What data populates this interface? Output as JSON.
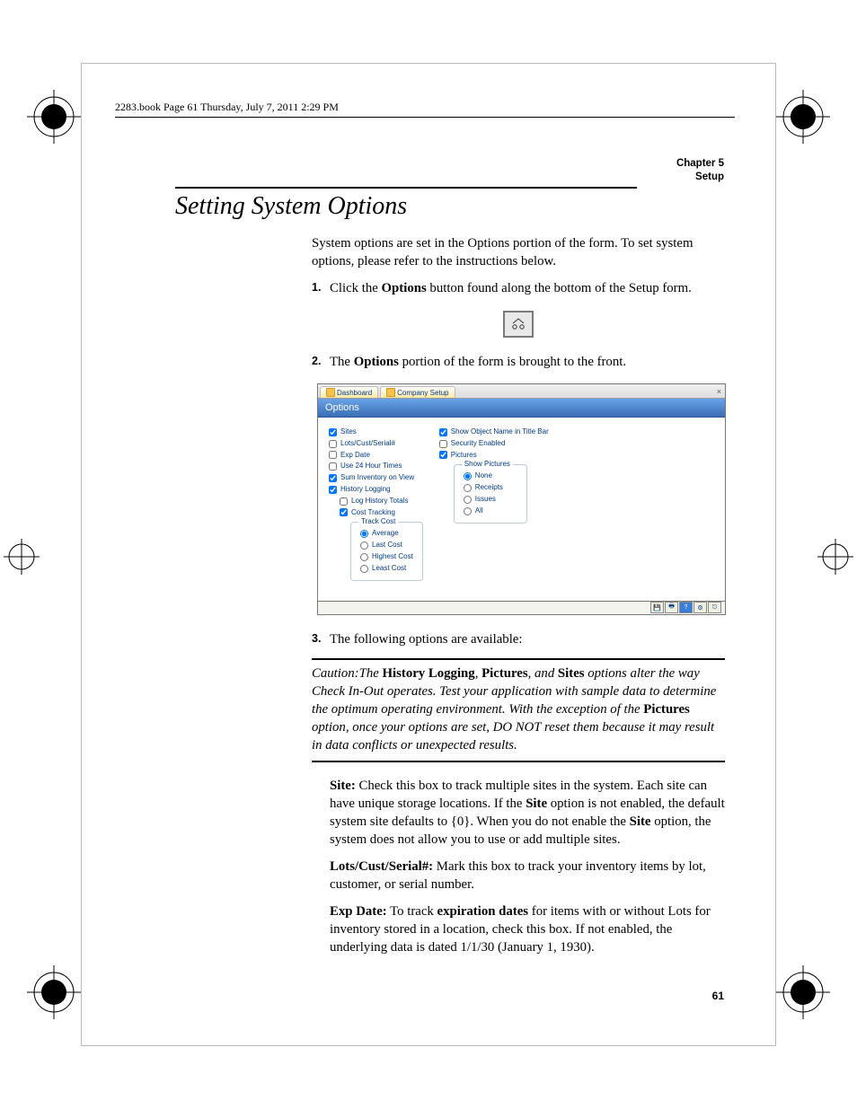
{
  "header_line": "2283.book  Page 61  Thursday, July 7, 2011  2:29 PM",
  "running_head": {
    "line1": "Chapter 5",
    "line2": "Setup"
  },
  "section_title": "Setting System Options",
  "intro": "System options are set in the Options portion of the form. To set system options, please refer to the instructions below.",
  "step1_num": "1.",
  "step1_pre": "Click the ",
  "step1_bold": "Options",
  "step1_post": " button found along the bottom of the Setup form.",
  "step2_num": "2.",
  "step2_pre": "The ",
  "step2_bold": "Options",
  "step2_post": " portion of the form is brought to the front.",
  "step3_num": "3.",
  "step3_text": "The following options are available:",
  "caution": {
    "pre": "Caution:The ",
    "b1": "History Logging",
    "mid1": ", ",
    "b2": "Pictures",
    "mid2": ", and ",
    "b3": "Sites",
    "post1": " options alter the way Check In-Out operates. Test your application with sample data to determine the optimum operating environment. With the exception of the ",
    "b4": "Pictures",
    "post2": " option, once your options are set, DO NOT reset them because it may result in data conflicts or unexpected results."
  },
  "defs": {
    "site": {
      "b": "Site:",
      "t1": " Check this box to track multiple sites in the system. Each site can have unique storage locations. If the ",
      "b2": "Site",
      "t2": " option is not enabled, the default system site defaults to {0}. When you do not enable the ",
      "b3": "Site",
      "t3": " option, the system does not allow you to use or add multiple sites."
    },
    "lots": {
      "b": "Lots/Cust/Serial#:",
      "t": " Mark this box to track your inventory items by lot, customer, or serial number."
    },
    "exp": {
      "b": "Exp Date:",
      "t1": " To track ",
      "b2": "expiration dates",
      "t2": " for items with or without Lots for inventory stored in a location, check this box. If not enabled, the underlying data is dated 1/1/30 (January 1, 1930)."
    }
  },
  "page_number": "61",
  "app": {
    "tab1": "Dashboard",
    "tab2": "Company Setup",
    "panel_title": "Options",
    "left": {
      "sites": "Sites",
      "lots": "Lots/Cust/Serial#",
      "exp": "Exp Date",
      "hour": "Use 24 Hour Times",
      "sum": "Sum Inventory on View",
      "hist": "History Logging",
      "log": "Log History Totals",
      "cost": "Cost Tracking",
      "track_legend": "Track Cost",
      "avg": "Average",
      "last": "Last Cost",
      "high": "Highest Cost",
      "least": "Least Cost"
    },
    "right": {
      "show_obj": "Show Object Name in Title Bar",
      "sec": "Security Enabled",
      "pics": "Pictures",
      "show_pics_legend": "Show Pictures",
      "none": "None",
      "receipts": "Receipts",
      "issues": "Issues",
      "all": "All"
    }
  }
}
